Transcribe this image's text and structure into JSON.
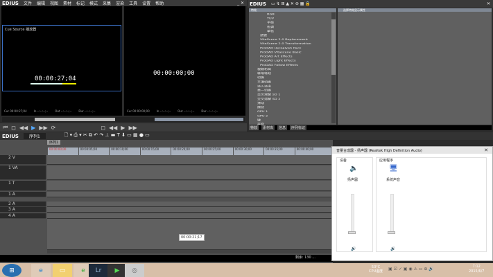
{
  "app": {
    "logo": "EDIUS",
    "menu": [
      "文件",
      "编辑",
      "视图",
      "素材",
      "标记",
      "模式",
      "采集",
      "渲染",
      "工具",
      "设置",
      "帮助"
    ]
  },
  "player": {
    "overlay": "Cue Source  播放器",
    "timecode": "00:00:27;04",
    "status": [
      "Cur 00:00:27;04",
      "In --:--:--;--",
      "Out --:--:--;--",
      "Dur --:--:--;--"
    ]
  },
  "recorder": {
    "timecode": "00:00:00;00",
    "status": [
      "Cur 00:00:00;00",
      "In --:--:--;--",
      "Out --:--:--;--",
      "Dur --:--:--;--"
    ]
  },
  "effects": {
    "header": "特效",
    "right_header": "选择特效显示属性",
    "tree": [
      "RGB",
      "YUV",
      "平衡",
      "色调",
      "单色",
      "滤镜",
      "VitaScene 2.0 Replacement",
      "VitaScene 2.0 Transformation",
      "ProDAD Heroglyph Pack",
      "ProDAD Vitascene Basic",
      "ProDAD Art Effects",
      "ProDAD Light Effects",
      "ProDAD Follow Effects",
      "视频布局",
      "转场特效",
      "切换",
      "平滑切换",
      "淡入淡出",
      "单一切换",
      "交叉溶解 SD 1",
      "交叉溶解 SD 2",
      "滑动",
      "擦拭",
      "GPU 1",
      "GPU 2",
      "键",
      "声音"
    ],
    "tabs": [
      "特效",
      "素材库",
      "信息",
      "序列标记"
    ]
  },
  "timeline": {
    "sequence": "序列1",
    "tab": "序列1",
    "ruler": [
      "00:00:00;00",
      "00:00:05;00",
      "00:00:10;00",
      "00:00:15;00",
      "00:00:20;00",
      "00:00:25;00",
      "00:00:30;00",
      "00:00:35;00",
      "00:00:40;00"
    ],
    "tracks": [
      "2 V",
      "1 VA",
      "1 T",
      "1 A",
      "2 A",
      "3 A",
      "4 A"
    ],
    "tooltip": "00:00:21;17",
    "status": "剩余: 130 ..."
  },
  "mixer": {
    "title": "音量合成器 - 扬声器 (Realtek High Definition Audio)",
    "device_label": "设备",
    "device": "扬声器",
    "apps_label": "应用程序",
    "app": "系统声音",
    "close": "✕",
    "device_level": 0,
    "app_level": 0
  },
  "tray": {
    "temp": "53°C",
    "cpu": "CPU温度",
    "time": "7:12",
    "date": "2015/6/7"
  },
  "taskbar": [
    "Lr"
  ]
}
